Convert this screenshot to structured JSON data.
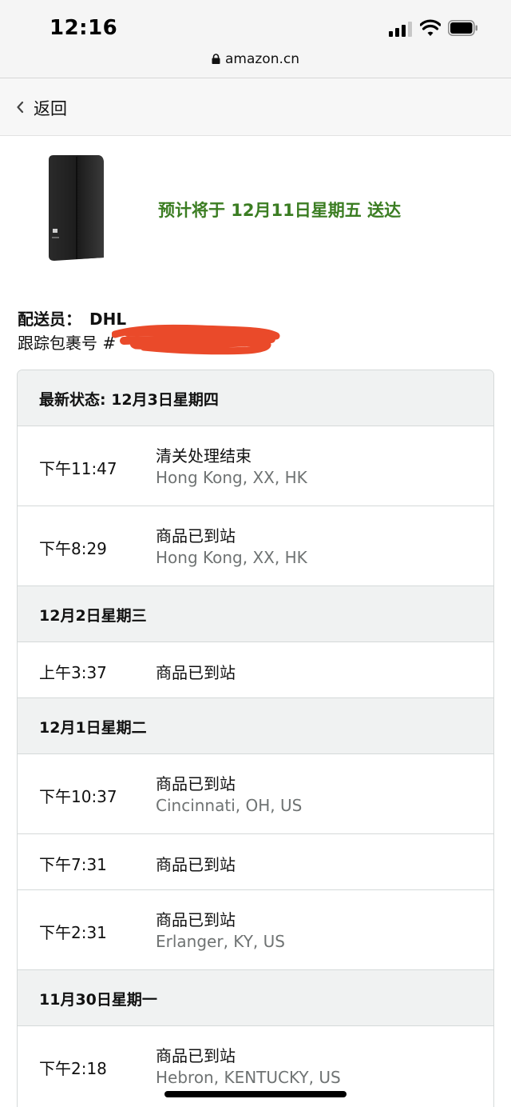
{
  "status_bar": {
    "time": "12:16",
    "url": "amazon.cn"
  },
  "nav": {
    "back_label": "返回"
  },
  "delivery": {
    "eta": "预计将于 12月11日星期五 送达",
    "carrier_label": "配送员：",
    "carrier_name": "DHL",
    "tracking_label": "跟踪包裹号 #"
  },
  "colors": {
    "eta_green": "#3b7d22",
    "header_bg": "#f0f2f2",
    "redaction": "#ea4a2a",
    "location_gray": "#6f7373"
  },
  "timeline": {
    "groups": [
      {
        "header": "最新状态: 12月3日星期四",
        "events": [
          {
            "time": "下午11:47",
            "status": "清关处理结束",
            "location": "Hong Kong, XX, HK"
          },
          {
            "time": "下午8:29",
            "status": "商品已到站",
            "location": "Hong Kong, XX, HK"
          }
        ]
      },
      {
        "header": "12月2日星期三",
        "events": [
          {
            "time": "上午3:37",
            "status": "商品已到站",
            "location": ""
          }
        ]
      },
      {
        "header": "12月1日星期二",
        "events": [
          {
            "time": "下午10:37",
            "status": "商品已到站",
            "location": "Cincinnati, OH, US"
          },
          {
            "time": "下午7:31",
            "status": "商品已到站",
            "location": ""
          },
          {
            "time": "下午2:31",
            "status": "商品已到站",
            "location": "Erlanger, KY, US"
          }
        ]
      },
      {
        "header": "11月30日星期一",
        "events": [
          {
            "time": "下午2:18",
            "status": "商品已到站",
            "location": "Hebron, KENTUCKY, US"
          }
        ]
      }
    ]
  }
}
